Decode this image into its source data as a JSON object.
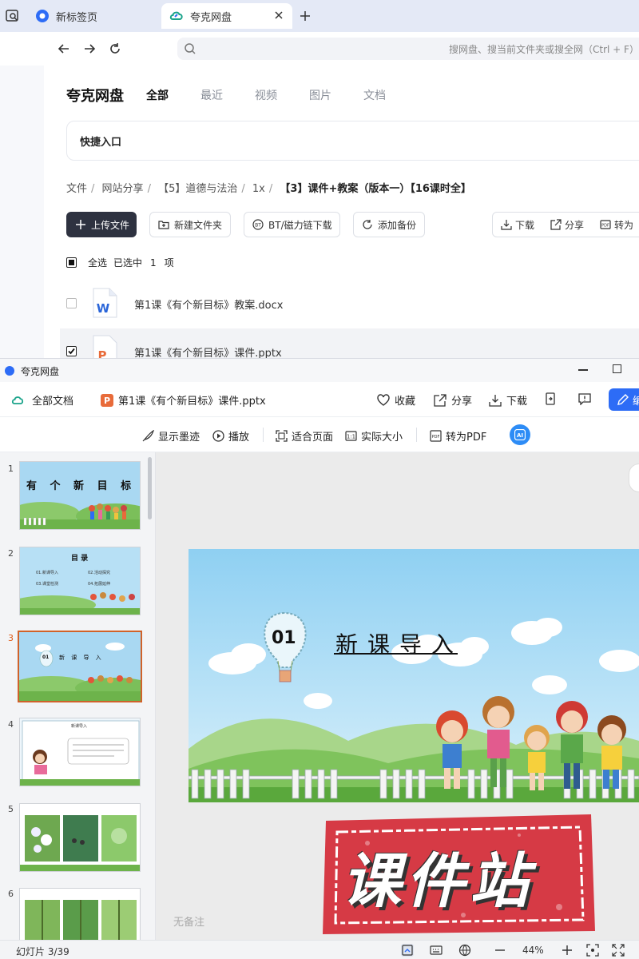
{
  "browser": {
    "tabs": [
      {
        "label": "新标签页",
        "active": false
      },
      {
        "label": "夸克网盘",
        "active": true
      }
    ],
    "address_placeholder": "搜网盘、搜当前文件夹或搜全网（Ctrl + F）"
  },
  "drive": {
    "brand": "夸克网盘",
    "nav_tabs": [
      "全部",
      "最近",
      "视频",
      "图片",
      "文档"
    ],
    "active_tab": "全部",
    "quick_entry": "快捷入口",
    "breadcrumbs": [
      "文件",
      "网站分享",
      "【5】道德与法治",
      "1x",
      "【3】课件+教案（版本一）【16课时全】"
    ],
    "actions": {
      "upload": "上传文件",
      "new_folder": "新建文件夹",
      "bt": "BT/磁力链下载",
      "backup": "添加备份",
      "download": "下载",
      "share": "分享",
      "convert": "转为"
    },
    "select_all": "全选",
    "selected_text": "已选中",
    "selected_count": "1",
    "selected_unit": "项",
    "files": [
      {
        "name": "第1课《有个新目标》教案.docx",
        "type": "docx",
        "checked": false
      },
      {
        "name": "第1课《有个新目标》课件.pptx",
        "type": "pptx",
        "checked": true
      }
    ]
  },
  "preview": {
    "window_title": "夸克网盘",
    "all_docs": "全部文档",
    "file_name": "第1课《有个新目标》课件.pptx",
    "actions": {
      "favorite": "收藏",
      "share": "分享",
      "download": "下载",
      "edit": "编"
    },
    "toolbar": {
      "ink": "显示墨迹",
      "play": "播放",
      "fit": "适合页面",
      "actual": "实际大小",
      "to_pdf": "转为PDF"
    },
    "slide_numbers": [
      "1",
      "2",
      "3",
      "4",
      "5",
      "6"
    ],
    "current_slide": 3,
    "thumbnails": {
      "t1_title": "有 个 新 目 标",
      "t2_title": "目 录",
      "t2_items": [
        "01.新课导入",
        "02.活动探究",
        "03.课堂检测",
        "04.拓展延伸"
      ],
      "t3_num": "01",
      "t3_title": "新 课 导 入",
      "t4_header": "新课导入"
    },
    "slide": {
      "number": "01",
      "title": "新课导入"
    },
    "watermark": "课件站",
    "notes": "无备注",
    "status": "幻灯片 3/39",
    "zoom": "44%"
  },
  "colors": {
    "accent": "#2d6cf6",
    "dark_button": "#2e3240",
    "current_slide_border": "#d0622a",
    "watermark_red": "#d63a45"
  }
}
